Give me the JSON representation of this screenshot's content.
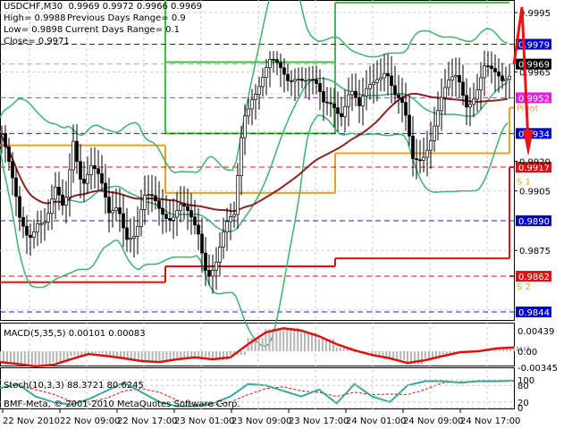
{
  "header": {
    "symbol_line": "USDCHF,M30  0.9969 0.9972 0.9966 0.9969",
    "high": "High= 0.9988",
    "prev_range": "Previous Days Range= 0.9",
    "low": "Low= 0.9898",
    "cur_range": "Current Days Range= 0.1",
    "close": "Close= 0.9971"
  },
  "colors": {
    "candle": "#000000",
    "bands": "#3cb371",
    "ma": "#8b2323",
    "pivot": "#f0a020",
    "resistance": "#40c040",
    "support": "#dd1111",
    "macd_hist": "#b4b4b4",
    "macd_signal": "#dd1111",
    "stoch_main": "#3aa89a",
    "stoch_signal": "#dd1111",
    "forecast": "#ee1111"
  },
  "chart_data": [
    {
      "type": "candlestick",
      "title": "USDCHF,M30",
      "ylim": [
        0.9838,
        1.0001
      ],
      "x_labels": [
        "22 Nov 2010",
        "22 Nov 09:00",
        "22 Nov 17:00",
        "23 Nov 01:00",
        "23 Nov 09:00",
        "23 Nov 17:00",
        "24 Nov 01:00",
        "24 Nov 09:00",
        "24 Nov 17:00"
      ],
      "close": [
        0.9934,
        0.9911,
        0.9889,
        0.9884,
        0.9893,
        0.9889,
        0.9902,
        0.9893,
        0.9934,
        0.9911,
        0.9916,
        0.9907,
        0.9893,
        0.9902,
        0.9884,
        0.988,
        0.9898,
        0.9902,
        0.9898,
        0.9893,
        0.9895,
        0.9889,
        0.9884,
        0.9866,
        0.9871,
        0.9884,
        0.9889,
        0.9943,
        0.9956,
        0.9961,
        0.9967,
        0.9965,
        0.9963,
        0.9967,
        0.9961,
        0.9956,
        0.9947,
        0.9952,
        0.9947,
        0.9956,
        0.9943,
        0.9956,
        0.9965,
        0.997,
        0.9952,
        0.9943,
        0.992,
        0.9925,
        0.9934,
        0.9947,
        0.9956,
        0.9963,
        0.9952,
        0.9956,
        0.9965,
        0.9961,
        0.9961,
        0.9969
      ],
      "axis_ticks": [
        "0.9995",
        "0.9965",
        "0.9920",
        "0.9905",
        "0.9875"
      ],
      "levels": [
        {
          "price": 0.9979,
          "text": "0.9979",
          "color": "#0000c8",
          "line": "#2020c0"
        },
        {
          "price": 0.9969,
          "text": "0.9969",
          "color": "#000000",
          "line": "#aaaaaa"
        },
        {
          "price": 0.9952,
          "text": "0.9952",
          "color": "#e020e0",
          "line": "#e020e0"
        },
        {
          "price": 0.9934,
          "text": "0.9934",
          "color": "#0000c8",
          "line": "#2020c0"
        },
        {
          "price": 0.9917,
          "text": "0.9917",
          "color": "#dd1111",
          "line": "#dd1111"
        },
        {
          "price": 0.989,
          "text": "0.9890",
          "color": "#0000c8",
          "line": "#2020c0"
        },
        {
          "price": 0.9862,
          "text": "0.9862",
          "color": "#dd1111",
          "line": "#dd1111"
        },
        {
          "price": 0.9844,
          "text": "0.9844",
          "color": "#0000c8",
          "line": "#2020c0"
        }
      ],
      "pivots": {
        "day_breaks": [
          0,
          18.5,
          37.5,
          57
        ],
        "pivot": [
          0.9928,
          0.9904,
          0.9924,
          0.9947
        ],
        "r1": [
          1.001,
          0.9934,
          1.0,
          null
        ],
        "r2": [
          1.001,
          0.997,
          1.0,
          null
        ],
        "s1": [
          0.9859,
          0.9867,
          0.9871,
          0.9917
        ],
        "s2": [
          null,
          null,
          null,
          0.9862
        ],
        "labels": [
          "Pivot",
          "S 1",
          "S 2"
        ]
      }
    },
    {
      "type": "line",
      "title": "MACD(5,35,5) 0.00101 0.00083",
      "ylim": [
        -0.00345,
        0.00439
      ],
      "axis_ticks": [
        "0.00439",
        "0.00",
        "-0.00345"
      ],
      "signal": [
        -0.0023,
        -0.0027,
        -0.0032,
        -0.0029,
        -0.0017,
        -0.0006,
        -0.001,
        -0.0015,
        -0.0021,
        -0.0023,
        -0.0017,
        -0.0013,
        -0.0017,
        -0.0013,
        0.0015,
        0.004,
        0.0049,
        0.0044,
        0.0032,
        0.0015,
        0.0002,
        -0.0008,
        -0.0015,
        -0.0025,
        -0.0019,
        -0.001,
        -0.0002,
        0.0,
        0.0006,
        0.0008
      ],
      "histogram": [
        -0.0025,
        -0.003,
        -0.0033,
        -0.0024,
        -0.001,
        -0.0004,
        -0.0012,
        -0.0018,
        -0.0023,
        -0.0021,
        -0.0014,
        -0.0012,
        -0.0019,
        -0.0008,
        0.0028,
        0.0048,
        0.005,
        0.004,
        0.0026,
        0.0008,
        -0.0002,
        -0.0012,
        -0.0018,
        -0.0028,
        -0.0015,
        -0.0006,
        0.0,
        0.0002,
        0.0008,
        0.001
      ]
    },
    {
      "type": "line",
      "title": "Stoch(10,3,3) 88.3721 80.6245",
      "ylim": [
        0,
        100
      ],
      "axis_ticks": [
        "100",
        "80",
        "20",
        "0"
      ],
      "main": [
        70,
        85,
        40,
        20,
        10,
        30,
        60,
        90,
        55,
        20,
        5,
        5,
        15,
        40,
        85,
        80,
        60,
        40,
        65,
        15,
        85,
        40,
        20,
        80,
        95,
        95,
        90,
        95,
        95,
        97
      ]
    }
  ],
  "footer": {
    "copyright": "BMF-Meta, © 2001-2010 MetaQuotes Software Corp."
  }
}
